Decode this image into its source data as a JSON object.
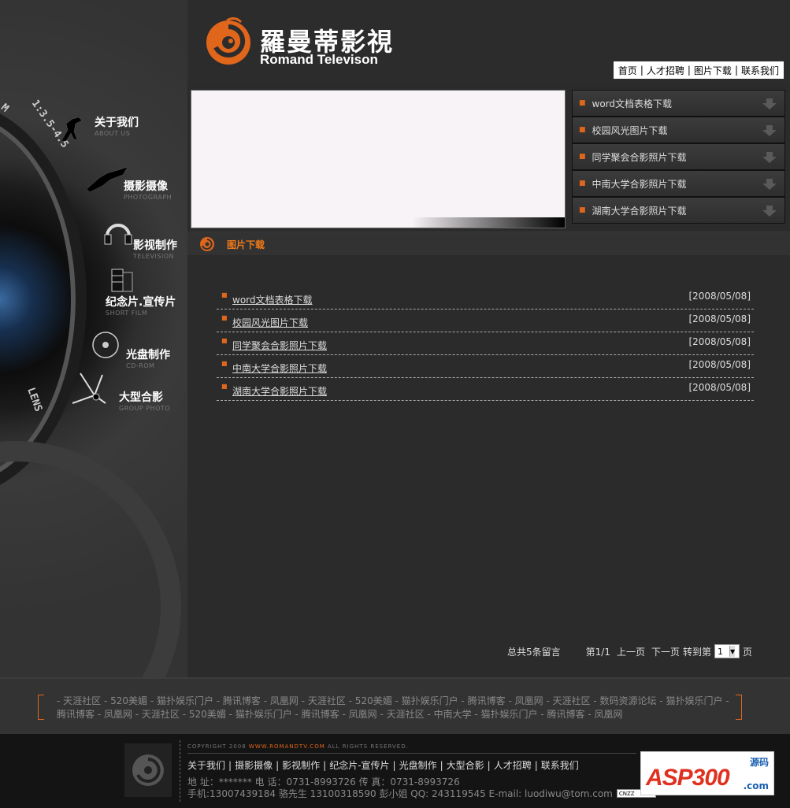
{
  "brand": {
    "name_cn": "羅曼蒂影視",
    "name_en": "Romand Televison",
    "accent": "#e0661c"
  },
  "top_nav": [
    "首页",
    "人才招聘",
    "图片下载",
    "联系我们"
  ],
  "side_nav": [
    {
      "cn": "关于我们",
      "en": "ABOUT US"
    },
    {
      "cn": "摄影摄像",
      "en": "PHOTOGRAPH"
    },
    {
      "cn": "影视制作",
      "en": "TELEVISION"
    },
    {
      "cn": "纪念片.宣传片",
      "en": "SHORT FILM"
    },
    {
      "cn": "光盘制作",
      "en": "CD-ROM"
    },
    {
      "cn": "大型合影",
      "en": "GROUP PHOTO"
    }
  ],
  "lens_text": {
    "top": "1:3.5-4.5",
    "left": "M",
    "lower": "LENS"
  },
  "quick_list": [
    "word文档表格下载",
    "校园风光图片下载",
    "同学聚会合影照片下载",
    "中南大学合影照片下载",
    "湖南大学合影照片下载"
  ],
  "section_title": "图片下载",
  "downloads": [
    {
      "title": "word文档表格下载",
      "date": "[2008/05/08]"
    },
    {
      "title": "校园风光图片下载",
      "date": "[2008/05/08]"
    },
    {
      "title": "同学聚会合影照片下载",
      "date": "[2008/05/08]"
    },
    {
      "title": "中南大学合影照片下载",
      "date": "[2008/05/08]"
    },
    {
      "title": "湖南大学合影照片下载",
      "date": "[2008/05/08]"
    }
  ],
  "pager": {
    "total": "总共5条留言",
    "page": "第1/1",
    "prev": "上一页",
    "next": "下一页",
    "jump": "转到第",
    "current": "1",
    "unit": "页"
  },
  "friend_links": "- 天涯社区 - 520美媚 - 猫扑娱乐门户 - 腾讯博客 - 凤凰网 - 天涯社区 - 520美媚 - 猫扑娱乐门户 - 腾讯博客 - 凤凰网 - 天涯社区 - 数码资源论坛 - 猫扑娱乐门户 - 腾讯博客 - 凤凰网 - 天涯社区 - 520美媚 - 猫扑娱乐门户 - 腾讯博客 - 凤凰网 - 天涯社区 - 中南大学 - 猫扑娱乐门户 - 腾讯博客 - 凤凰网",
  "footer": {
    "copyright_pre": "COPYRIGHT 2008 ",
    "copyright_site": "WWW.ROMANDTV.COM",
    "copyright_post": " ALL RIGHTS RESERVED.",
    "nav": [
      "关于我们",
      "摄影摄像",
      "影视制作",
      "纪念片-宣传片",
      "光盘制作",
      "大型合影",
      "人才招聘",
      "联系我们"
    ],
    "address": "地 址：******* 电 话：0731-8993726 传 真：0731-8993726",
    "contact": "手机:13007439184 骆先生 13100318590 彭小姐 QQ: 243119545 E-mail: luodiwu@tom.com",
    "cnzz": "CNZZ",
    "asp_logo": "ASP300",
    "asp_sub": "源码",
    "asp_com": ".com"
  }
}
